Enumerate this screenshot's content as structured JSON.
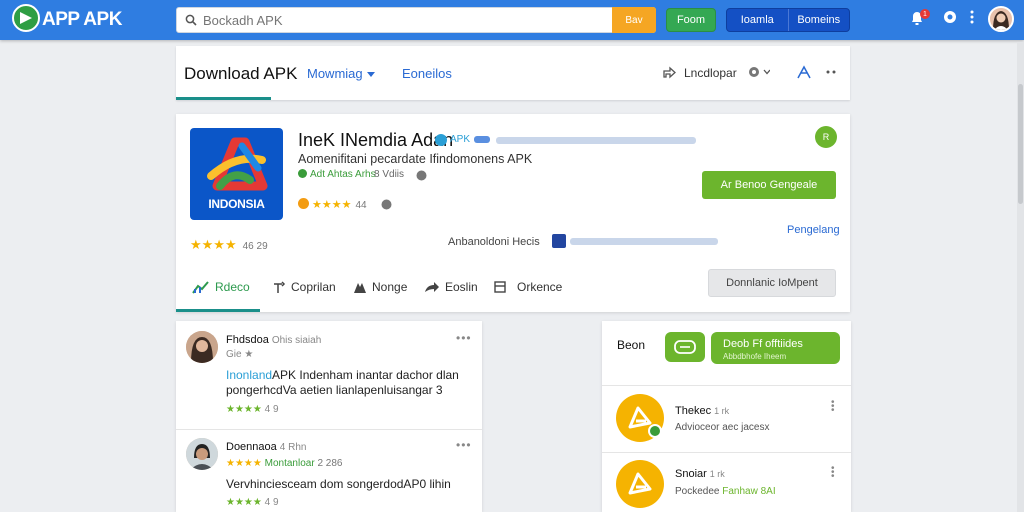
{
  "topbar": {
    "logo_text": "APP APK",
    "search_placeholder": "Bockadh APK",
    "search_button": "Bav",
    "green_button": "Foom",
    "seg_left": "Ioamla",
    "seg_right": "Bomeins",
    "notif_count": "1"
  },
  "header": {
    "title": "Download APK",
    "tab1": "Mowmiag",
    "tab2": "Eoneilos",
    "right_text": "Lncdlopar"
  },
  "app": {
    "icon_text": "INDONSIA",
    "title": "IneK INemdia Adan",
    "title_tag": "APK",
    "subtitle": "Aomenifitani pecardate Ifindomonens APK",
    "developer": "Adt Ahtas Arhs",
    "developer_meta": "8 Vdiis",
    "rating_stars": "★★★★",
    "rating_count": "44",
    "install_label": "Ar Benoo Gengeale",
    "badge_label": "R",
    "big_stars": "★★★★",
    "big_count": "46 29",
    "advert_text": "Anbanoldoni Hecis",
    "pengelang": "Pengelang",
    "tabs": [
      {
        "label": "Rdeco",
        "icon": "chart-icon"
      },
      {
        "label": "Coprilan",
        "icon": "share-icon"
      },
      {
        "label": "Nonge",
        "icon": "home-icon"
      },
      {
        "label": "Eoslin",
        "icon": "forward-icon"
      },
      {
        "label": "Orkence",
        "icon": "archive-icon"
      }
    ],
    "download_label": "Donnlanic IoMpent"
  },
  "comments": [
    {
      "name": "Fhdsdoa",
      "meta": "Ohis siaiah",
      "sub": "Gie ★",
      "text_hl": "Inonland",
      "text_rest": "APK Indenham inantar dachor dlan pongerhcdVa aetien lianlapenluisangar 3",
      "stars": "★★★★",
      "count": "4 9"
    },
    {
      "name": "Doennaoa",
      "meta": "4 Rhn",
      "sub_stars": "★★★★",
      "sub_text": "Montanloar",
      "sub_count": "2 286",
      "text_hl": "",
      "text_rest": "Vervhinciesceam dom songerdodAP0 lihin",
      "stars": "★★★★",
      "count": "4 9"
    }
  ],
  "side": {
    "title": "Beon",
    "big_btn_l1": "Deob Ff offtiides",
    "big_btn_l2": "Abbdbhofe Iheem",
    "items": [
      {
        "name": "Thekec",
        "meta": "1 rk",
        "sub": "Advioceor aec jacesx",
        "sub_green": ""
      },
      {
        "name": "Snoiar",
        "meta": "1 rk",
        "sub": "Pockedee",
        "sub_green": "Fanhaw 8AI"
      }
    ]
  },
  "colors": {
    "topbar": "#2f7de1",
    "accent_green": "#6cb52d",
    "accent_teal": "#1a8f8a",
    "link_blue": "#2a6ad3"
  }
}
